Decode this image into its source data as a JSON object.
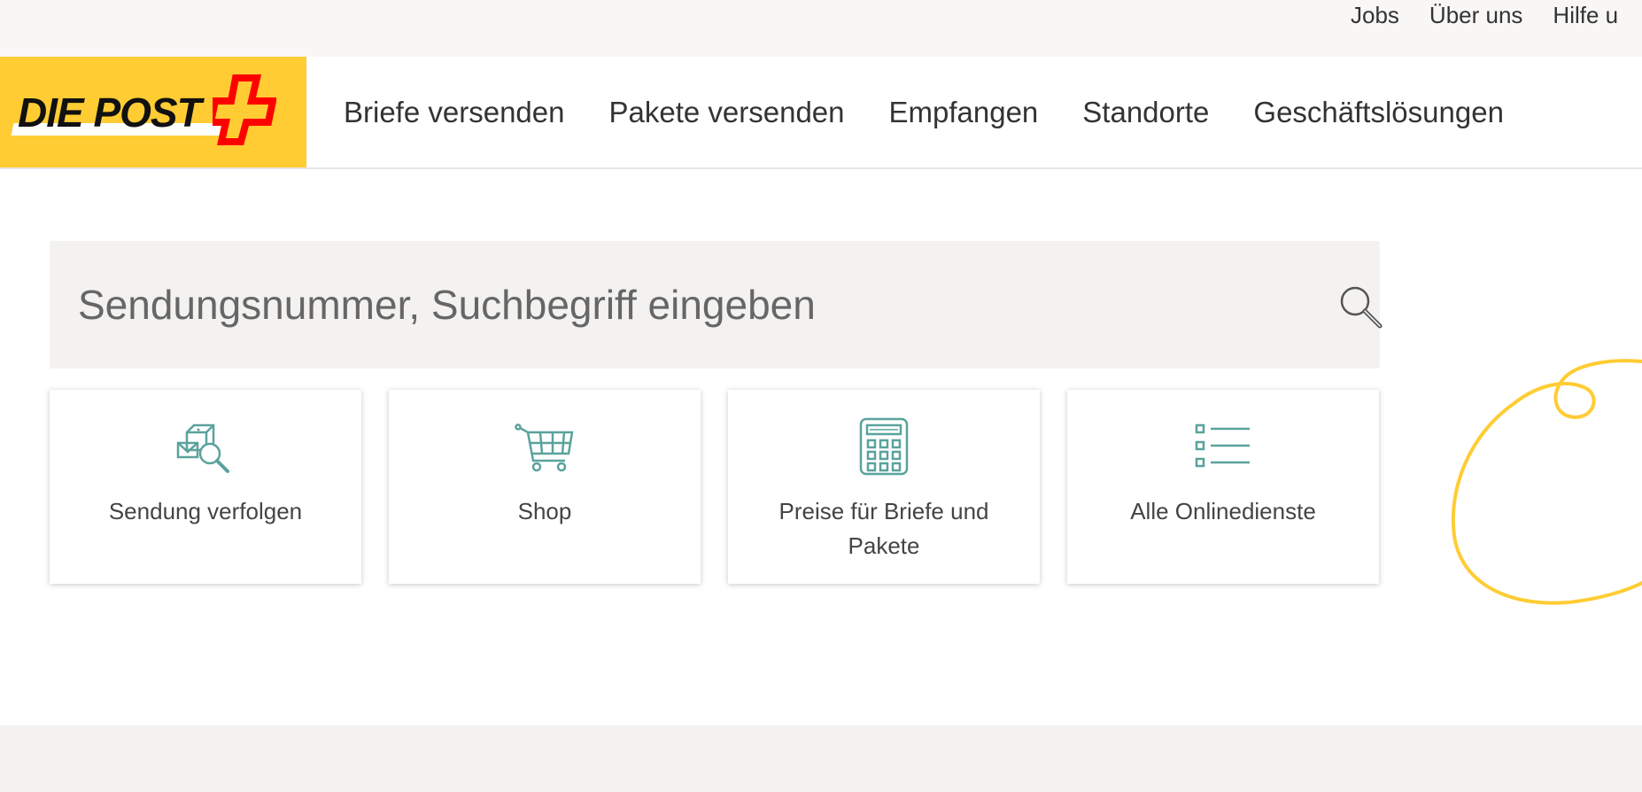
{
  "topbar": {
    "links": [
      "Jobs",
      "Über uns",
      "Hilfe u"
    ]
  },
  "logo": {
    "text": "DIE POST",
    "colors": {
      "background": "#ffcc33",
      "cross": "#ff0000"
    }
  },
  "nav": {
    "items": [
      "Briefe versenden",
      "Pakete versenden",
      "Empfangen",
      "Standorte",
      "Geschäftslösungen"
    ]
  },
  "search": {
    "placeholder": "Sendungsnummer, Suchbegriff eingeben",
    "value": "",
    "icon": "search-icon"
  },
  "tiles": [
    {
      "label": "Sendung verfolgen",
      "icon": "parcel-search-icon"
    },
    {
      "label": "Shop",
      "icon": "cart-icon"
    },
    {
      "label": "Preise für Briefe und Pakete",
      "icon": "calculator-icon"
    },
    {
      "label": "Alle Onlinedienste",
      "icon": "list-icon"
    }
  ],
  "colors": {
    "accent_icon": "#5aa39c",
    "brand_yellow": "#ffcc33",
    "decoration": "#ffcc33"
  }
}
